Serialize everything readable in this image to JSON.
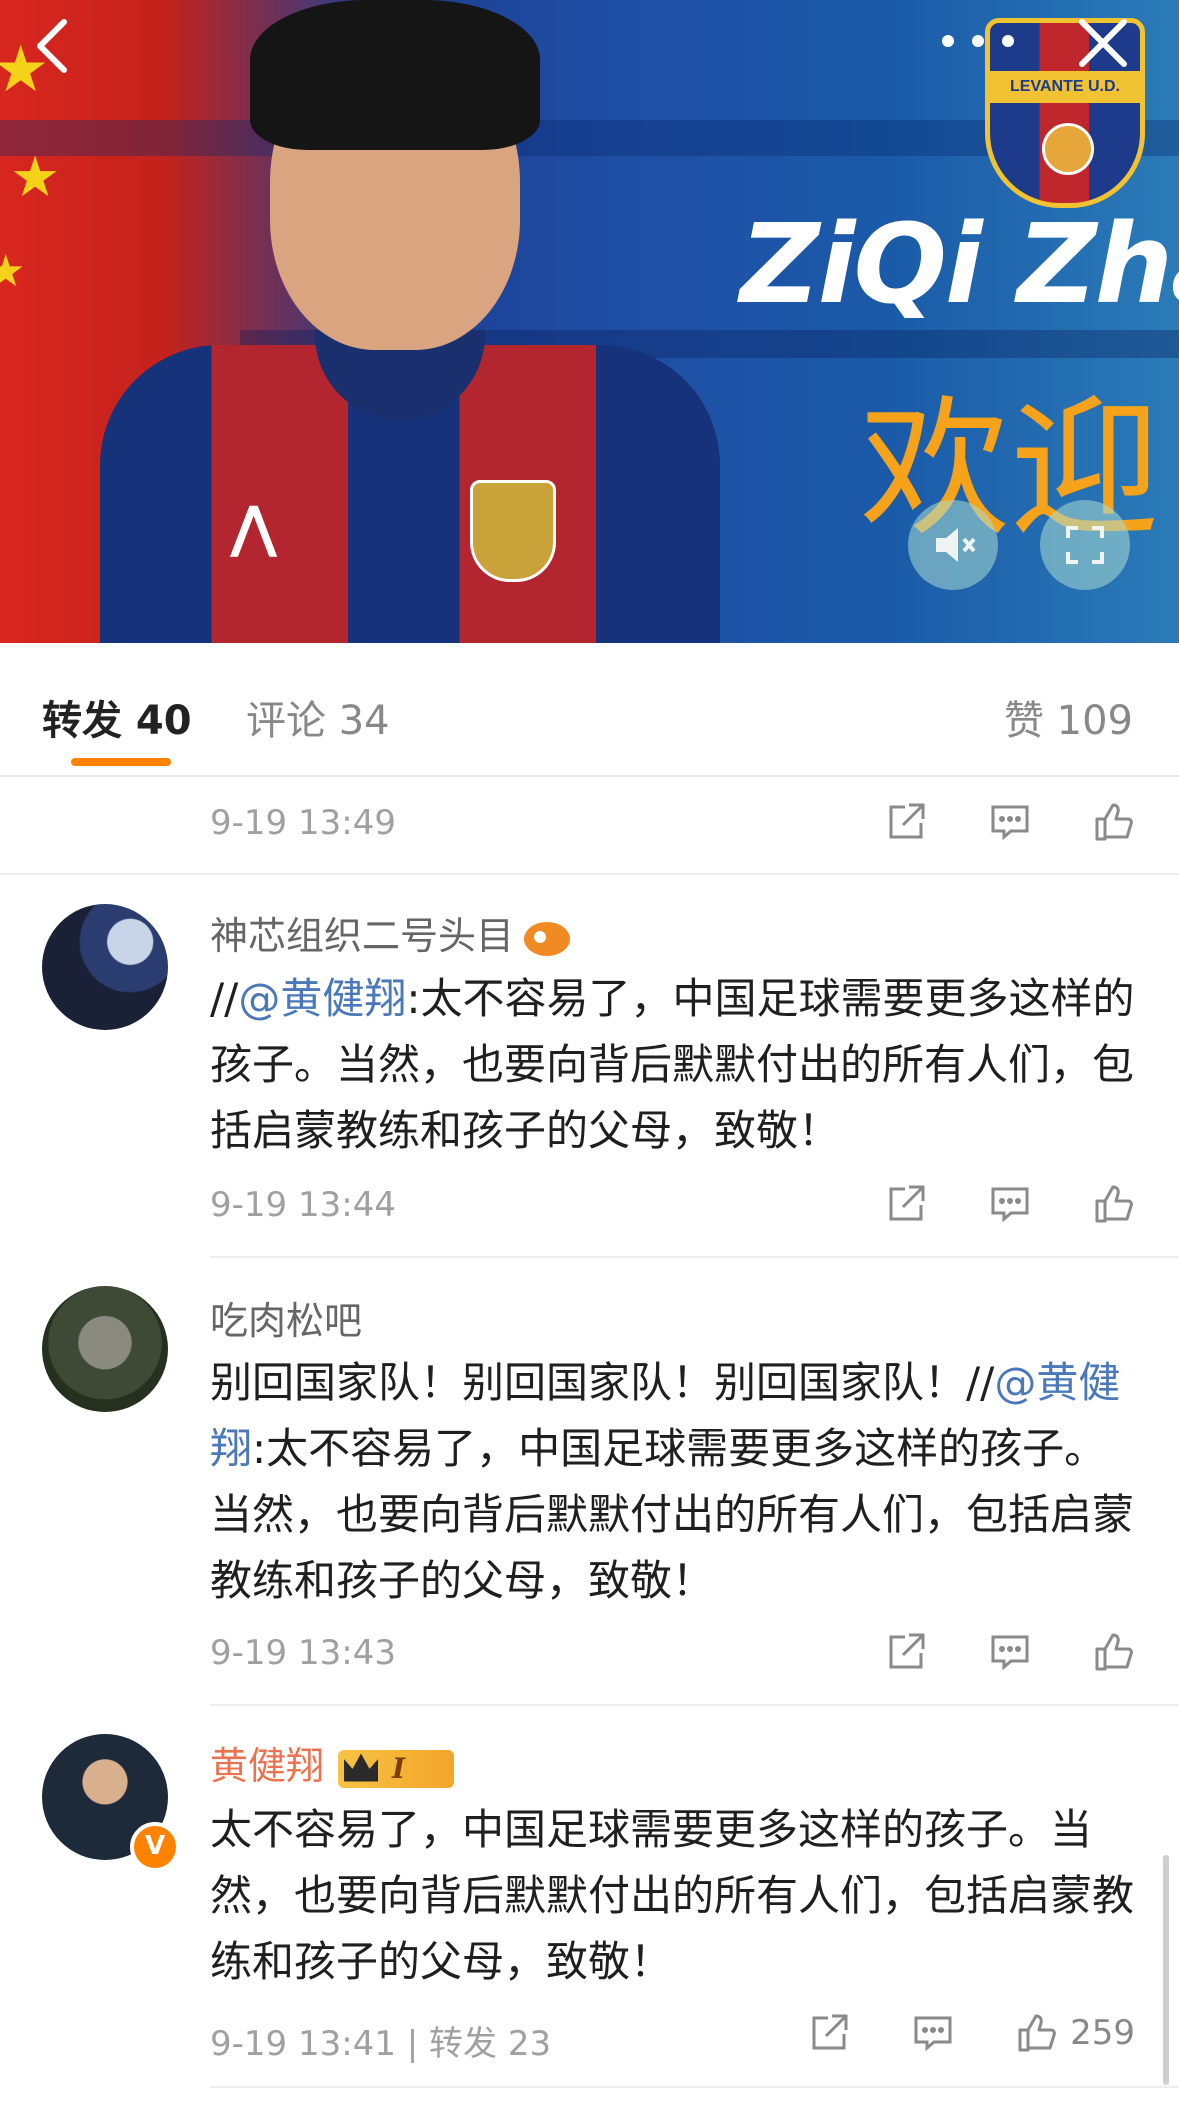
{
  "video": {
    "name_overlay": "ZiQi Zha",
    "welcome_overlay": "欢迎",
    "club_badge_text": "LEVANTE U.D.",
    "controls": {
      "back_icon": "chevron-left-icon",
      "more_icon": "more-dots-icon",
      "close_icon": "close-icon",
      "mute_icon": "mute-icon",
      "fullscreen_icon": "fullscreen-icon"
    }
  },
  "tabs": {
    "repost_label": "转发 40",
    "comment_label": "评论 34",
    "like_label": "赞 109",
    "active": "repost",
    "accent_color": "#ff8200"
  },
  "feed": {
    "partial_item": {
      "timestamp": "9-19 13:49"
    },
    "items": [
      {
        "user": "神芯组织二号头目",
        "prefix": "//",
        "mention": "@黄健翔",
        "text": ":太不容易了，中国足球需要更多这样的孩子。当然，也要向背后默默付出的所有人们，包括启蒙教练和孩子的父母，致敬！",
        "timestamp": "9-19 13:44"
      },
      {
        "user": "吃肉松吧",
        "prefix": "别回国家队！别回国家队！别回国家队！//",
        "mention": "@黄健翔",
        "text": ":太不容易了，中国足球需要更多这样的孩子。当然，也要向背后默默付出的所有人们，包括启蒙教练和孩子的父母，致敬！",
        "timestamp": "9-19 13:43"
      },
      {
        "user": "黄健翔",
        "user_color": "#eb7350",
        "badge_level": "I",
        "text": "太不容易了，中国足球需要更多这样的孩子。当然，也要向背后默默付出的所有人们，包括启蒙教练和孩子的父母，致敬！",
        "timestamp": "9-19 13:41",
        "repost_text": "| 转发 23",
        "like_count": "259"
      }
    ]
  }
}
